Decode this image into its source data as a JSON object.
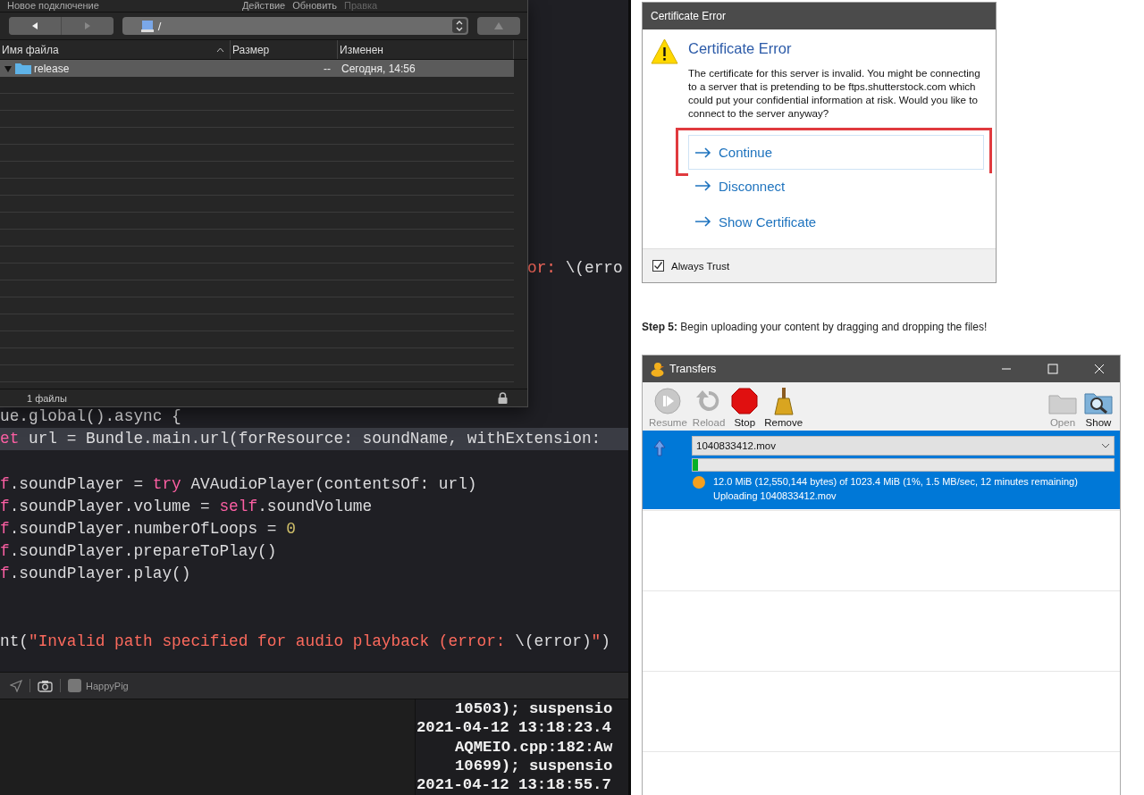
{
  "ftp_window": {
    "menu": [
      {
        "label": "Новое подключение",
        "disabled": false
      },
      {
        "label": "Действие",
        "disabled": false
      },
      {
        "label": "Обновить",
        "disabled": false
      },
      {
        "label": "Правка",
        "disabled": true
      }
    ],
    "toolbar": {
      "back": {
        "disabled": false
      },
      "forward": {
        "disabled": true
      },
      "path": "/",
      "up": {
        "disabled": true
      }
    },
    "columns": [
      {
        "label": "Имя файла",
        "sorted": true
      },
      {
        "label": "Размер",
        "sorted": false
      },
      {
        "label": "Изменен",
        "sorted": false
      }
    ],
    "files": [
      {
        "name": "release",
        "size": "--",
        "modified": "Сегодня, 14:56",
        "expanded": true,
        "selected": true
      }
    ],
    "status": "1 файлы"
  },
  "editor": {
    "partial_line": [
      {
        "text": "or: ",
        "kind": "string"
      },
      {
        "text": "\\(erro",
        "kind": "plain"
      }
    ],
    "lines": [
      {
        "kind": "code",
        "highlighted": false,
        "tokens": [
          {
            "text": "ue.global().async {",
            "kind": "plain"
          }
        ]
      },
      {
        "kind": "code",
        "highlighted": true,
        "tokens": [
          {
            "text": "et",
            "kind": "keyword"
          },
          {
            "text": " url = Bundle.main.url(forResource: soundName, withExtension: ",
            "kind": "plain"
          }
        ]
      },
      {
        "kind": "blank"
      },
      {
        "kind": "code",
        "highlighted": false,
        "tokens": [
          {
            "text": "f",
            "kind": "keyword"
          },
          {
            "text": ".soundPlayer = ",
            "kind": "plain"
          },
          {
            "text": "try",
            "kind": "keyword"
          },
          {
            "text": " AVAudioPlayer(contentsOf: url)",
            "kind": "plain"
          }
        ]
      },
      {
        "kind": "code",
        "highlighted": false,
        "tokens": [
          {
            "text": "f",
            "kind": "keyword"
          },
          {
            "text": ".soundPlayer.volume = ",
            "kind": "plain"
          },
          {
            "text": "self",
            "kind": "keyword"
          },
          {
            "text": ".soundVolume",
            "kind": "plain"
          }
        ]
      },
      {
        "kind": "code",
        "highlighted": false,
        "tokens": [
          {
            "text": "f",
            "kind": "keyword"
          },
          {
            "text": ".soundPlayer.numberOfLoops = ",
            "kind": "plain"
          },
          {
            "text": "0",
            "kind": "number"
          }
        ]
      },
      {
        "kind": "code",
        "highlighted": false,
        "tokens": [
          {
            "text": "f",
            "kind": "keyword"
          },
          {
            "text": ".soundPlayer.prepareToPlay()",
            "kind": "plain"
          }
        ]
      },
      {
        "kind": "code",
        "highlighted": false,
        "tokens": [
          {
            "text": "f",
            "kind": "keyword"
          },
          {
            "text": ".soundPlayer.play()",
            "kind": "plain"
          }
        ]
      },
      {
        "kind": "blank"
      },
      {
        "kind": "blank"
      },
      {
        "kind": "code",
        "highlighted": false,
        "tokens": [
          {
            "text": "nt(",
            "kind": "plain"
          },
          {
            "text": "\"Invalid path specified for audio playback (error: ",
            "kind": "string"
          },
          {
            "text": "\\(error)",
            "kind": "plain"
          },
          {
            "text": "\"",
            "kind": "string"
          },
          {
            "text": ")",
            "kind": "plain"
          }
        ]
      }
    ]
  },
  "debug_bar": {
    "app": "HappyPig"
  },
  "console": {
    "lines": [
      {
        "kind": "continuation",
        "text": "10503); suspensio"
      },
      {
        "kind": "entry",
        "text": "2021-04-12 13:18:23.4"
      },
      {
        "kind": "continuation",
        "text": "AQMEIO.cpp:182:Aw"
      },
      {
        "kind": "continuation",
        "text": "10699); suspensio"
      },
      {
        "kind": "entry",
        "text": "2021-04-12 13:18:55.7"
      }
    ]
  },
  "certificate_dialog": {
    "title": "Certificate Error",
    "heading": "Certificate Error",
    "message": "The certificate for this server is invalid. You might be connecting to a server that is pretending to be ftps.shutterstock.com which could put your confidential information at risk. Would you like to connect to the server anyway?",
    "options": [
      {
        "label": "Continue",
        "highlighted": true
      },
      {
        "label": "Disconnect",
        "highlighted": false
      },
      {
        "label": "Show Certificate",
        "highlighted": false
      }
    ],
    "always_trust": {
      "label": "Always Trust",
      "checked": true
    }
  },
  "step_text": "**Step 5:** Begin uploading your content by dragging and dropping the files!",
  "transfers_window": {
    "title": "Transfers",
    "left_buttons": [
      {
        "kind": "resume",
        "label": "Resume",
        "disabled": true
      },
      {
        "kind": "reload",
        "label": "Reload",
        "disabled": true
      },
      {
        "kind": "stop",
        "label": "Stop",
        "disabled": false
      },
      {
        "kind": "remove",
        "label": "Remove",
        "disabled": false
      }
    ],
    "right_buttons": [
      {
        "kind": "open",
        "label": "Open",
        "disabled": true
      },
      {
        "kind": "show",
        "label": "Show",
        "disabled": false
      }
    ],
    "items": [
      {
        "file": "1040833412.mov",
        "level": 0.012,
        "status": "12.0 MiB (12,550,144 bytes) of 1023.4 MiB (1%, 1.5 MB/sec, 12 minutes remaining)",
        "activity": "Uploading 1040833412.mov",
        "selected": true
      }
    ]
  }
}
